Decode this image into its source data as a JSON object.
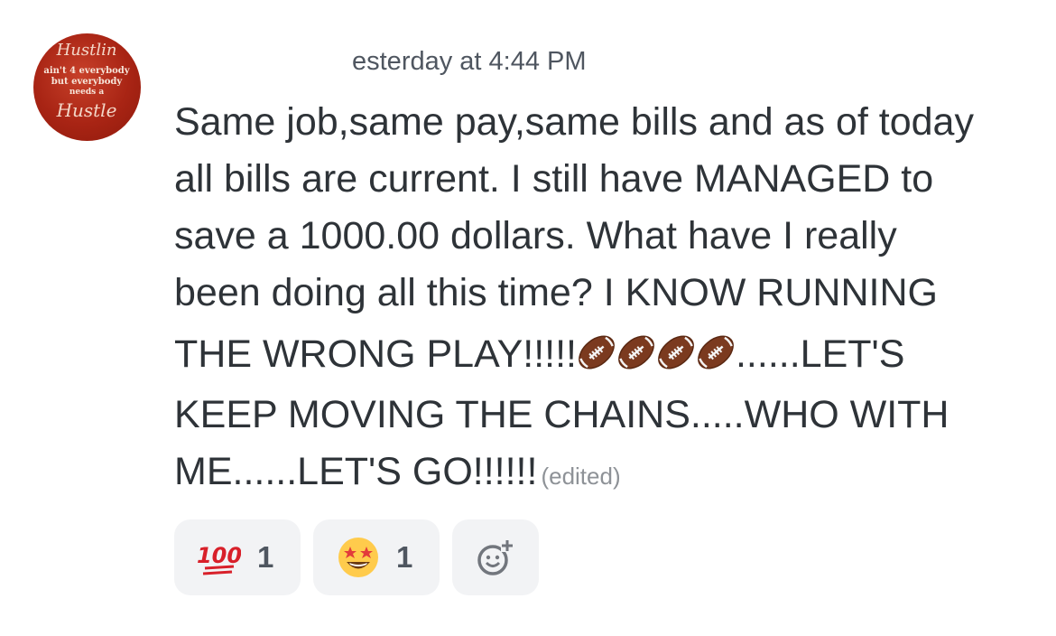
{
  "message": {
    "timestamp": "esterday at 4:44 PM",
    "lines": [
      "Same job,same pay,same bills and as of today",
      "all bills are current. I still have MANAGED to",
      "save a 1000.00 dollars. What have I really",
      "been doing all this time? I KNOW RUNNING"
    ],
    "line5_before": "THE WRONG PLAY!!!!!",
    "line5_after": "......LET'S",
    "line6": "KEEP MOVING THE CHAINS.....WHO WITH",
    "line7": "ME......LET'S GO!!!!!!",
    "edited_label": "(edited)",
    "inline_emoji": [
      "american-football-icon",
      "american-football-icon",
      "american-football-icon",
      "american-football-icon"
    ]
  },
  "avatar": {
    "lines": [
      "Hustlin",
      "ain't 4 everybody",
      "but everybody",
      "needs a",
      "Hustle"
    ]
  },
  "reactions": [
    {
      "emoji": "hundred-points-icon",
      "count": "1"
    },
    {
      "emoji": "star-struck-icon",
      "count": "1"
    }
  ],
  "add_reaction_icon": "add-reaction-icon"
}
